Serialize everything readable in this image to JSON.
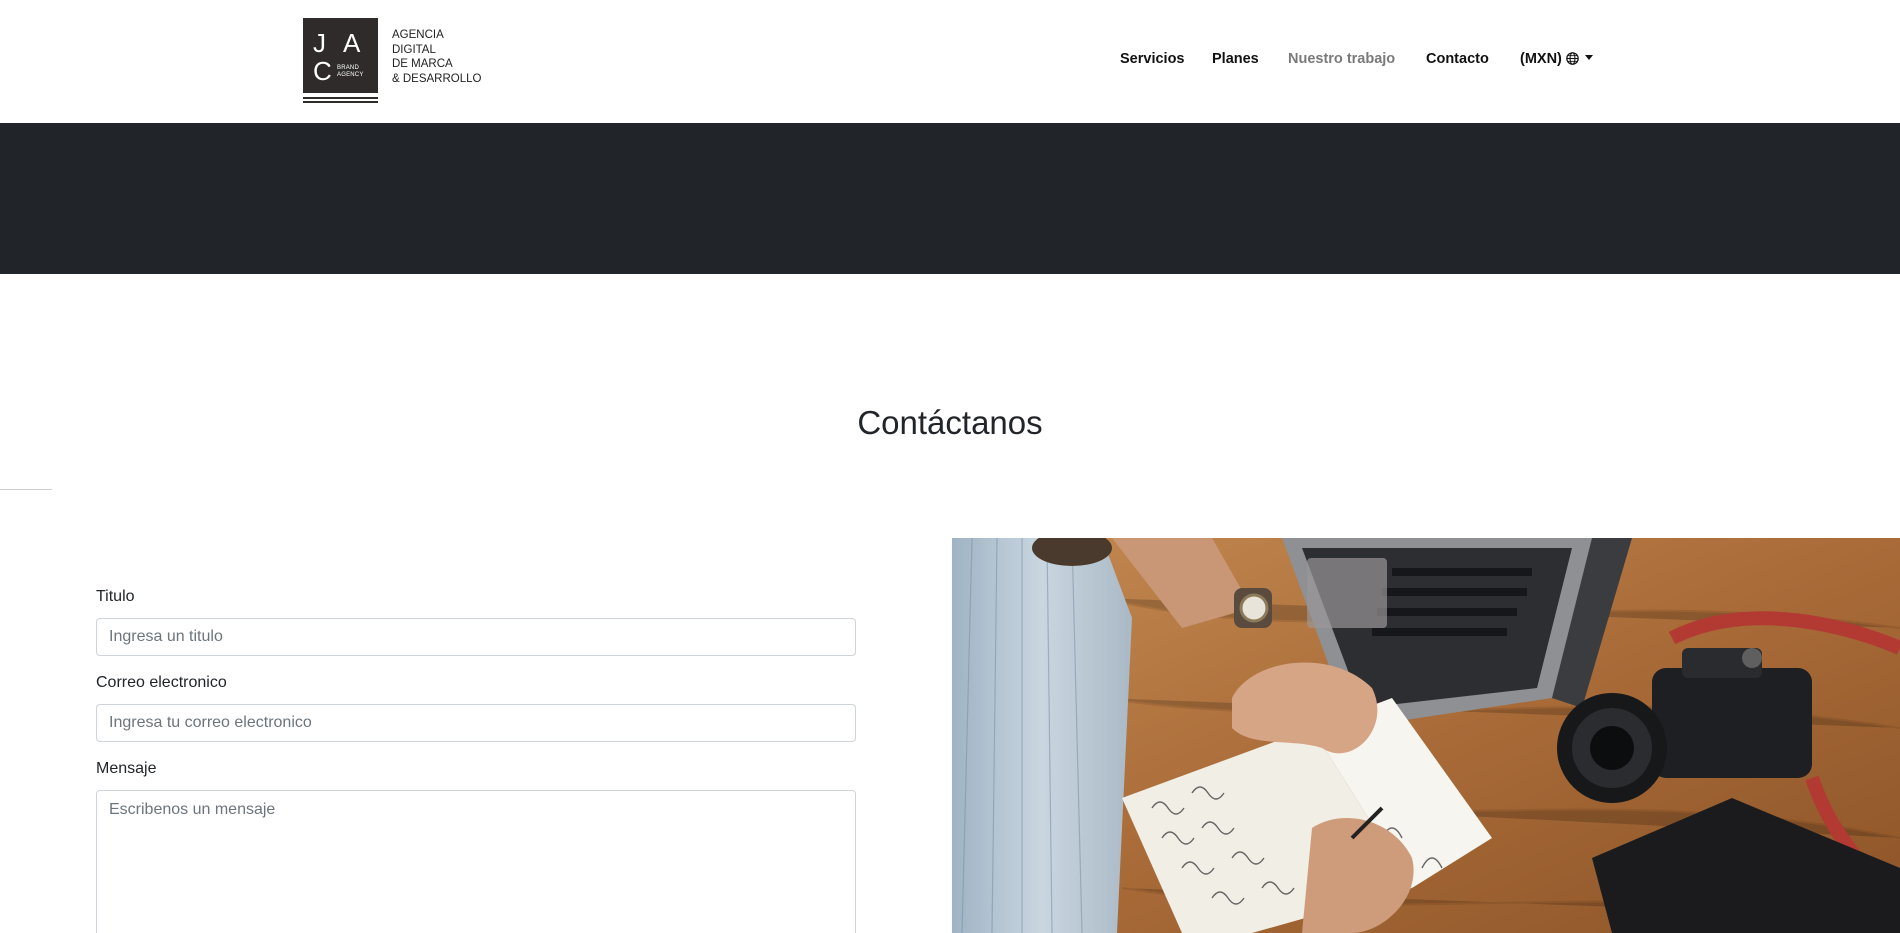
{
  "brand": {
    "logo_letters": {
      "j": "J",
      "a": "A",
      "c": "C"
    },
    "logo_sub": [
      "BRAND",
      "AGENCY"
    ],
    "tagline": [
      "AGENCIA",
      "DIGITAL",
      "DE MARCA",
      "& DESARROLLO"
    ],
    "color": "#2f2b2b"
  },
  "nav": {
    "items": [
      {
        "label": "Servicios"
      },
      {
        "label": "Planes"
      },
      {
        "label": "Nuestro trabajo"
      },
      {
        "label": "Contacto"
      }
    ],
    "currency_label": "(MXN)",
    "currency_icon": "globe-icon",
    "dropdown_icon": "caret-down-icon"
  },
  "hero": {
    "color": "#212429"
  },
  "contact": {
    "title": "Contáctanos",
    "fields": {
      "titulo": {
        "label": "Titulo",
        "placeholder": "Ingresa un titulo"
      },
      "correo": {
        "label": "Correo electronico",
        "placeholder": "Ingresa tu correo electronico"
      },
      "mensaje": {
        "label": "Mensaje",
        "placeholder": "Escribenos un mensaje"
      }
    }
  },
  "colors": {
    "text": "#212529",
    "muted_nav": "#7a7a7a",
    "input_border": "#ced4da",
    "placeholder": "#6c757d"
  }
}
